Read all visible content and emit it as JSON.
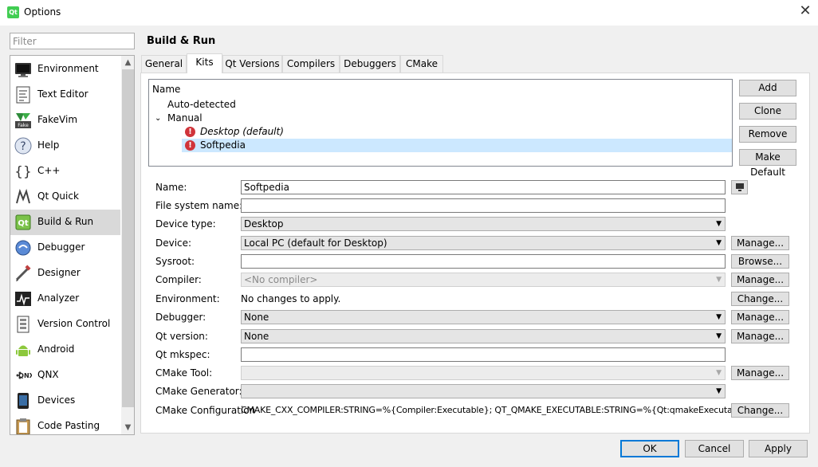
{
  "window": {
    "title": "Options",
    "app_icon": "qt-logo-icon",
    "close": "✕"
  },
  "filter": {
    "placeholder": "Filter",
    "value": ""
  },
  "categories": [
    {
      "label": "Environment",
      "icon": "monitor-icon"
    },
    {
      "label": "Text Editor",
      "icon": "text-editor-icon"
    },
    {
      "label": "FakeVim",
      "icon": "fakevim-icon"
    },
    {
      "label": "Help",
      "icon": "help-icon"
    },
    {
      "label": "C++",
      "icon": "cpp-braces-icon"
    },
    {
      "label": "Qt Quick",
      "icon": "qt-quick-icon"
    },
    {
      "label": "Build & Run",
      "icon": "build-run-icon",
      "selected": true
    },
    {
      "label": "Debugger",
      "icon": "debugger-icon"
    },
    {
      "label": "Designer",
      "icon": "designer-icon"
    },
    {
      "label": "Analyzer",
      "icon": "analyzer-icon"
    },
    {
      "label": "Version Control",
      "icon": "version-control-icon"
    },
    {
      "label": "Android",
      "icon": "android-icon"
    },
    {
      "label": "QNX",
      "icon": "qnx-icon"
    },
    {
      "label": "Devices",
      "icon": "devices-icon"
    },
    {
      "label": "Code Pasting",
      "icon": "code-pasting-icon"
    }
  ],
  "page": {
    "title": "Build & Run",
    "tabs": [
      "General",
      "Kits",
      "Qt Versions",
      "Compilers",
      "Debuggers",
      "CMake"
    ],
    "active_tab": "Kits"
  },
  "kits_tree": {
    "header": "Name",
    "auto_detected": "Auto-detected",
    "manual": "Manual",
    "items": [
      {
        "label": "Desktop (default)",
        "italic": true,
        "status_icon": "error-icon"
      },
      {
        "label": "Softpedia",
        "selected": true,
        "status_icon": "error-icon"
      }
    ]
  },
  "kit_buttons": {
    "add": "Add",
    "clone": "Clone",
    "remove": "Remove",
    "make_default": "Make Default"
  },
  "form": {
    "name": {
      "label": "Name:",
      "value": "Softpedia"
    },
    "file_system_name": {
      "label": "File system name:",
      "value": ""
    },
    "device_type": {
      "label": "Device type:",
      "value": "Desktop"
    },
    "device": {
      "label": "Device:",
      "value": "Local PC (default for Desktop)",
      "button": "Manage..."
    },
    "sysroot": {
      "label": "Sysroot:",
      "value": "",
      "button": "Browse..."
    },
    "compiler": {
      "label": "Compiler:",
      "value": "<No compiler>",
      "button": "Manage..."
    },
    "environment": {
      "label": "Environment:",
      "value": "No changes to apply.",
      "button": "Change..."
    },
    "debugger": {
      "label": "Debugger:",
      "value": "None",
      "button": "Manage..."
    },
    "qt_version": {
      "label": "Qt version:",
      "value": "None",
      "button": "Manage..."
    },
    "qt_mkspec": {
      "label": "Qt mkspec:",
      "value": ""
    },
    "cmake_tool": {
      "label": "CMake Tool:",
      "value": "",
      "button": "Manage..."
    },
    "cmake_generator": {
      "label": "CMake Generator:",
      "value": ""
    },
    "cmake_configuration": {
      "label": "CMake Configuration",
      "value": "CMAKE_CXX_COMPILER:STRING=%{Compiler:Executable}; QT_QMAKE_EXECUTABLE:STRING=%{Qt:qmakeExecutable}",
      "button": "Change..."
    }
  },
  "dialog_buttons": {
    "ok": "OK",
    "cancel": "Cancel",
    "apply": "Apply"
  }
}
